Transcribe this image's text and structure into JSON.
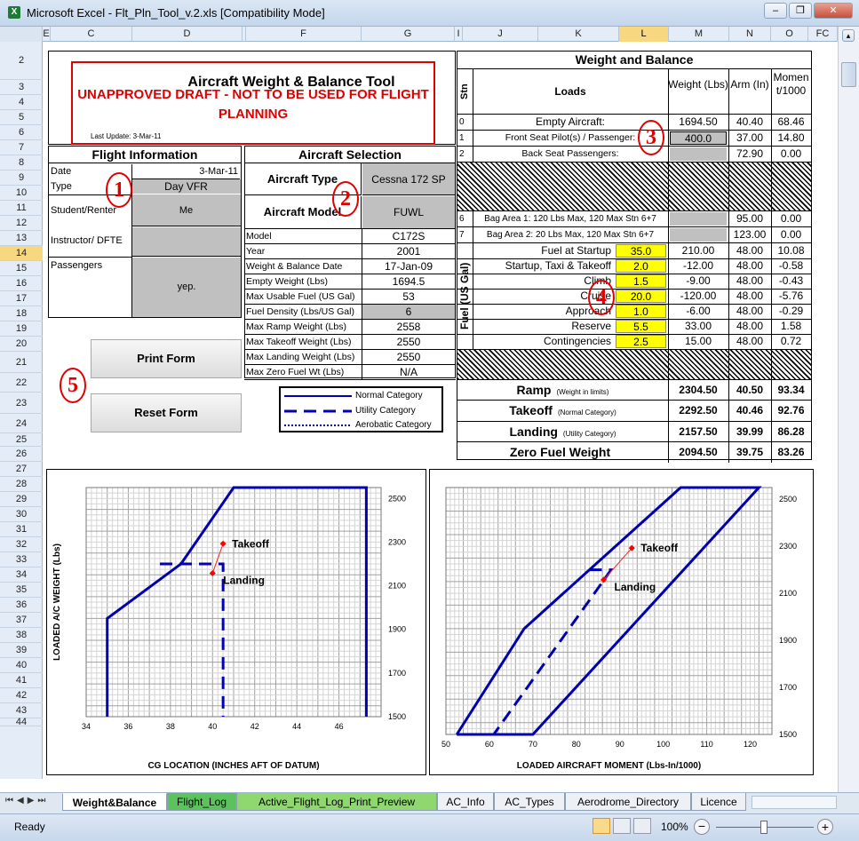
{
  "window": {
    "title": "Microsoft Excel - Flt_Pln_Tool_v.2.xls  [Compatibility Mode]",
    "minimize_glyph": "–",
    "restore_glyph": "❐",
    "close_glyph": "✕",
    "icon_letter": "X"
  },
  "columns": [
    "E",
    "C",
    "D",
    "",
    "F",
    "G",
    "I",
    "J",
    "K",
    "L",
    "M",
    "N",
    "O",
    "FC"
  ],
  "rows": [
    "2",
    "3",
    "4",
    "5",
    "6",
    "7",
    "8",
    "9",
    "10",
    "11",
    "12",
    "13",
    "14",
    "15",
    "16",
    "17",
    "18",
    "19",
    "20",
    "21",
    "22",
    "23",
    "24",
    "25",
    "26",
    "27",
    "28",
    "29",
    "30",
    "31",
    "32",
    "33",
    "34",
    "35",
    "36",
    "37",
    "38",
    "39",
    "40",
    "41",
    "42",
    "43",
    "44"
  ],
  "header": {
    "title": "Aircraft Weight & Balance Tool",
    "warning": "UNAPPROVED DRAFT - NOT TO BE USED FOR FLIGHT PLANNING",
    "last_update": "Last Update:  3-Mar-11"
  },
  "flight_info": {
    "heading": "Flight Information",
    "date_label": "Date",
    "date": "3-Mar-11",
    "type_label": "Type",
    "type": "Day VFR",
    "student_label": "Student/Renter",
    "student": "Me",
    "instructor_label": "Instructor/ DFTE",
    "instructor": "",
    "passengers_label": "Passengers",
    "passengers": "yep."
  },
  "aircraft": {
    "heading": "Aircraft Selection",
    "type_label": "Aircraft Type",
    "type": "Cessna 172 SP",
    "model_label": "Aircraft Model",
    "model": "FUWL",
    "specs": [
      [
        "Model",
        "C172S"
      ],
      [
        "Year",
        "2001"
      ],
      [
        "Weight & Balance Date",
        "17-Jan-09"
      ],
      [
        "Empty Weight (Lbs)",
        "1694.5"
      ],
      [
        "Max Usable Fuel (US Gal)",
        "53"
      ],
      [
        "Fuel Density (Lbs/US Gal)",
        "6"
      ],
      [
        "Max Ramp Weight (Lbs)",
        "2558"
      ],
      [
        "Max Takeoff Weight (Lbs)",
        "2550"
      ],
      [
        "Max Landing Weight (Lbs)",
        "2550"
      ],
      [
        "Max Zero Fuel Wt (Lbs)",
        "N/A"
      ]
    ]
  },
  "legend": {
    "normal": "Normal Category",
    "utility": "Utility Category",
    "aerobatic": "Aerobatic Category"
  },
  "buttons": {
    "print": "Print Form",
    "reset": "Reset Form"
  },
  "markers": [
    "1",
    "2",
    "3",
    "4",
    "5"
  ],
  "wb": {
    "heading": "Weight and Balance",
    "stn_label": "Stn",
    "loads_label": "Loads",
    "weight_label": "Weight (Lbs)",
    "arm_label": "Arm (In)",
    "moment_label": "Moment/1000",
    "stations": [
      {
        "stn": "0",
        "load": "Empty Aircraft:",
        "weight": "1694.50",
        "arm": "40.40",
        "moment": "68.46"
      },
      {
        "stn": "1",
        "load": "Front Seat Pilot(s) / Passenger:",
        "weight": "400.0",
        "arm": "37.00",
        "moment": "14.80"
      },
      {
        "stn": "2",
        "load": "Back Seat Passengers:",
        "weight": "",
        "arm": "72.90",
        "moment": "0.00"
      }
    ],
    "bags": [
      {
        "stn": "6",
        "load": "Bag Area 1: 120 Lbs Max, 120 Max Stn 6+7",
        "weight": "",
        "arm": "95.00",
        "moment": "0.00"
      },
      {
        "stn": "7",
        "load": "Bag Area 2: 20 Lbs Max, 120 Max Stn 6+7",
        "weight": "",
        "arm": "123.00",
        "moment": "0.00"
      }
    ],
    "fuel_label": "Fuel (US Gal)",
    "fuel": [
      {
        "load": "Fuel at Startup",
        "gal": "35.0",
        "weight": "210.00",
        "arm": "48.00",
        "moment": "10.08"
      },
      {
        "load": "Startup, Taxi & Takeoff",
        "gal": "2.0",
        "weight": "-12.00",
        "arm": "48.00",
        "moment": "-0.58"
      },
      {
        "load": "Climb",
        "gal": "1.5",
        "weight": "-9.00",
        "arm": "48.00",
        "moment": "-0.43"
      },
      {
        "load": "Cruise",
        "gal": "20.0",
        "weight": "-120.00",
        "arm": "48.00",
        "moment": "-5.76"
      },
      {
        "load": "Approach",
        "gal": "1.0",
        "weight": "-6.00",
        "arm": "48.00",
        "moment": "-0.29"
      },
      {
        "load": "Reserve",
        "gal": "5.5",
        "weight": "33.00",
        "arm": "48.00",
        "moment": "1.58"
      },
      {
        "load": "Contingencies",
        "gal": "2.5",
        "weight": "15.00",
        "arm": "48.00",
        "moment": "0.72"
      }
    ],
    "totals": [
      {
        "label": "Ramp",
        "note": "(Weight in limits)",
        "weight": "2304.50",
        "arm": "40.50",
        "moment": "93.34"
      },
      {
        "label": "Takeoff",
        "note": "(Normal Category)",
        "weight": "2292.50",
        "arm": "40.46",
        "moment": "92.76"
      },
      {
        "label": "Landing",
        "note": "(Utility Category)",
        "weight": "2157.50",
        "arm": "39.99",
        "moment": "86.28"
      },
      {
        "label": "Zero Fuel Weight",
        "note": "",
        "weight": "2094.50",
        "arm": "39.75",
        "moment": "83.26"
      }
    ]
  },
  "chart_data": [
    {
      "type": "line",
      "xlabel": "CG LOCATION (INCHES AFT OF DATUM)",
      "ylabel": "LOADED A/C WEIGHT  (Lbs)",
      "xlim": [
        34,
        48
      ],
      "ylim": [
        1500,
        2550
      ],
      "xticks": [
        34,
        36,
        38,
        40,
        42,
        44,
        46
      ],
      "yticks": [
        1500,
        1700,
        1900,
        2100,
        2300,
        2500
      ],
      "grid": true,
      "series": [
        {
          "name": "Normal Category",
          "style": "solid",
          "points": [
            [
              35,
              1500
            ],
            [
              35,
              1950
            ],
            [
              38.5,
              2200
            ],
            [
              41,
              2550
            ],
            [
              47.3,
              2550
            ],
            [
              47.3,
              1500
            ]
          ]
        },
        {
          "name": "Utility Category",
          "style": "dashed",
          "points": [
            [
              37.5,
              2200
            ],
            [
              40.5,
              2200
            ],
            [
              40.5,
              1500
            ]
          ]
        },
        {
          "name": "cg",
          "style": "marker",
          "points": [
            [
              40.5,
              2292.5
            ],
            [
              40,
              2157.5
            ]
          ]
        }
      ],
      "annotations": [
        {
          "text": "Takeoff",
          "x": 40.5,
          "y": 2292.5
        },
        {
          "text": "Landing",
          "x": 40,
          "y": 2157.5
        }
      ]
    },
    {
      "type": "line",
      "xlabel": "LOADED AIRCRAFT MOMENT (Lbs-In/1000)",
      "ylabel": "LOADED A/C WEIGHT  (Lbs)",
      "xlim": [
        50,
        125
      ],
      "ylim": [
        1500,
        2550
      ],
      "xticks": [
        50,
        60,
        70,
        80,
        90,
        100,
        110,
        120
      ],
      "yticks": [
        1500,
        1700,
        1900,
        2100,
        2300,
        2500
      ],
      "grid": true,
      "series": [
        {
          "name": "Normal Category",
          "style": "solid",
          "points": [
            [
              52.5,
              1500
            ],
            [
              68,
              1950
            ],
            [
              104,
              2550
            ],
            [
              122,
              2550
            ],
            [
              70,
              1500
            ],
            [
              52.5,
              1500
            ]
          ]
        },
        {
          "name": "Utility Category",
          "style": "dashed",
          "points": [
            [
              83,
              2200
            ],
            [
              88,
              2200
            ],
            [
              61,
              1500
            ]
          ]
        },
        {
          "name": "cg",
          "style": "marker",
          "points": [
            [
              92.76,
              2292.5
            ],
            [
              86.28,
              2157.5
            ]
          ]
        }
      ],
      "annotations": [
        {
          "text": "Takeoff",
          "x": 92.76,
          "y": 2292.5
        },
        {
          "text": "Landing",
          "x": 86.28,
          "y": 2157.5
        }
      ]
    }
  ],
  "tabs": [
    "Weight&Balance",
    "Flight_Log",
    "Active_Flight_Log_Print_Preview",
    "AC_Info",
    "AC_Types",
    "Aerodrome_Directory",
    "Licence"
  ],
  "status": {
    "ready": "Ready",
    "zoom": "100%",
    "minus": "−",
    "plus": "+"
  }
}
